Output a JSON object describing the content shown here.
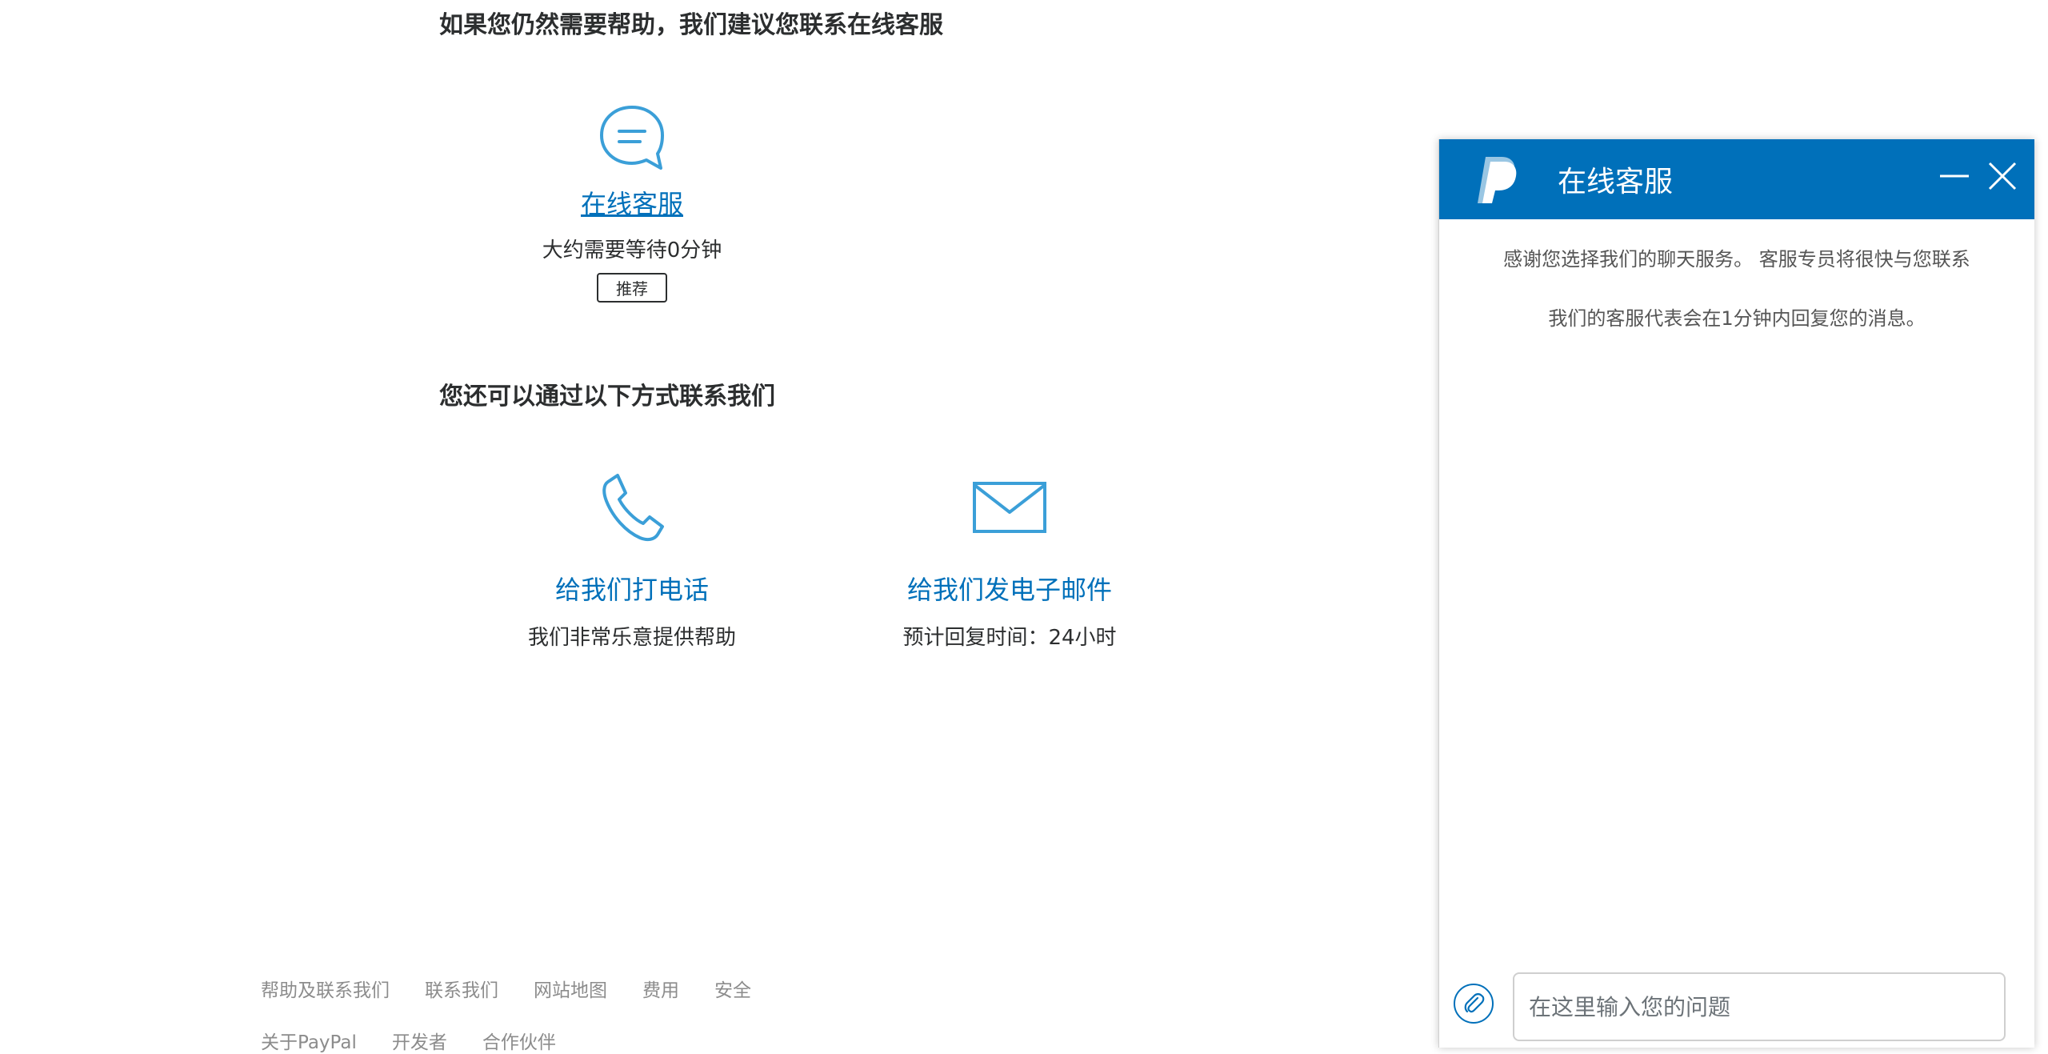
{
  "main": {
    "heading_primary": "如果您仍然需要帮助，我们建议您联系在线客服",
    "heading_secondary": "您还可以通过以下方式联系我们",
    "chat_option": {
      "icon": "chat-bubble-icon",
      "title": "在线客服",
      "wait_text": "大约需要等待0分钟",
      "badge": "推荐"
    },
    "phone_option": {
      "icon": "phone-icon",
      "title": "给我们打电话",
      "subtitle": "我们非常乐意提供帮助"
    },
    "email_option": {
      "icon": "envelope-icon",
      "title": "给我们发电子邮件",
      "subtitle": "预计回复时间：24小时"
    }
  },
  "footer": {
    "row1": [
      "帮助及联系我们",
      "联系我们",
      "网站地图",
      "费用",
      "安全"
    ],
    "row2": [
      "关于PayPal",
      "开发者",
      "合作伙伴"
    ]
  },
  "chat_window": {
    "title": "在线客服",
    "logo": "paypal-logo-icon",
    "minimize_icon": "minimize-icon",
    "close_icon": "close-icon",
    "messages": [
      "感谢您选择我们的聊天服务。 客服专员将很快与您联系",
      "我们的客服代表会在1分钟内回复您的消息。"
    ],
    "attach_icon": "paperclip-icon",
    "input_placeholder": "在这里输入您的问题",
    "input_value": ""
  },
  "colors": {
    "accent": "#0070ba",
    "icon_stroke": "#3b9fd8",
    "text": "#2c2e2f",
    "footer_text": "#8c8c8c"
  }
}
